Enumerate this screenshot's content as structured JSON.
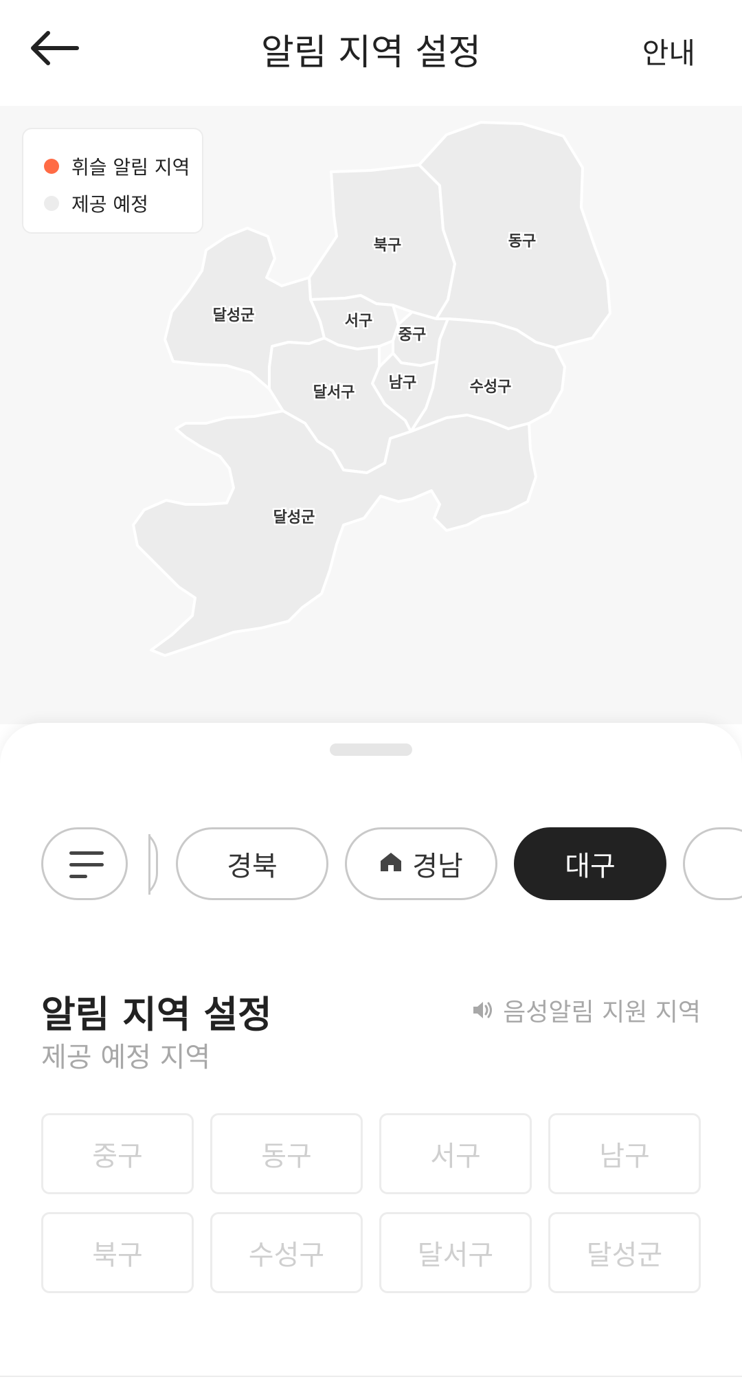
{
  "header": {
    "title": "알림 지역 설정",
    "guide_label": "안내",
    "back_icon": "arrow-left-icon"
  },
  "legend": {
    "items": [
      {
        "label": "휘슬 알림 지역",
        "color": "#ff6b45"
      },
      {
        "label": "제공 예정",
        "color": "#ececec"
      }
    ]
  },
  "map": {
    "labels": [
      "북구",
      "동구",
      "달성군",
      "서구",
      "중구",
      "달서구",
      "남구",
      "수성구",
      "달성군"
    ],
    "fill_color": "#ececec",
    "border_color": "#ffffff",
    "background": "#f7f7f7"
  },
  "tabs": {
    "filter_icon": "filter-lines-icon",
    "home_icon": "home-icon",
    "items": [
      {
        "label": "경북",
        "active": false
      },
      {
        "label": "경남",
        "active": false,
        "icon": "home-icon"
      },
      {
        "label": "대구",
        "active": true
      }
    ]
  },
  "section": {
    "title": "알림 지역 설정",
    "subtitle": "제공 예정 지역",
    "voice_note": "음성알림 지원 지역",
    "voice_icon": "speaker-icon"
  },
  "regions": [
    "중구",
    "동구",
    "서구",
    "남구",
    "북구",
    "수성구",
    "달서구",
    "달성군"
  ],
  "colors": {
    "accent": "#ff6b45",
    "active_chip": "#222222",
    "disabled_text": "#cfcfcf"
  }
}
